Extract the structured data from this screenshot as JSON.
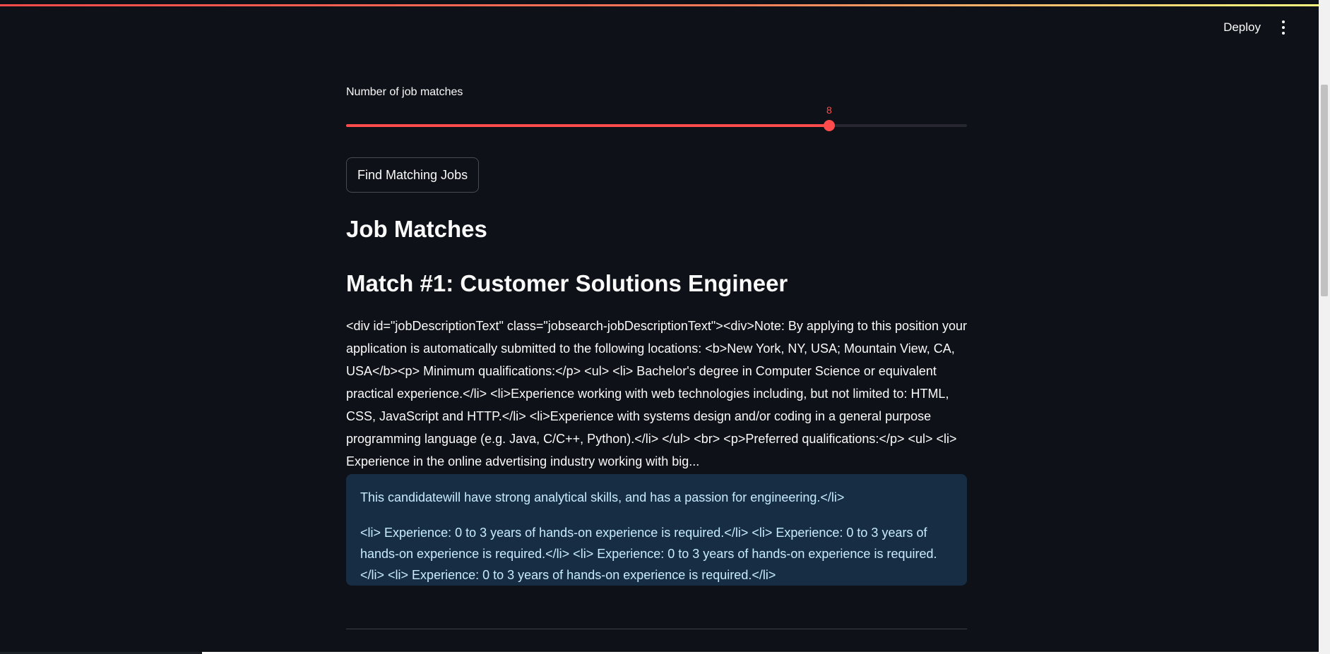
{
  "header": {
    "deploy_label": "Deploy",
    "menu_icon": "kebab-menu-icon"
  },
  "colors": {
    "background": "#0e1117",
    "accent": "#ff4b4b",
    "info_background": "#172d43",
    "info_text": "#c7ebff"
  },
  "slider": {
    "label": "Number of job matches",
    "value": 8,
    "fraction": 0.778
  },
  "actions": {
    "find_label": "Find Matching Jobs"
  },
  "results": {
    "heading": "Job Matches",
    "matches": [
      {
        "title": "Match #1: Customer Solutions Engineer",
        "description": "<div id=\"jobDescriptionText\" class=\"jobsearch-jobDescriptionText\"><div>Note: By applying to this position your application is automatically submitted to the following locations: <b>New York, NY, USA; Mountain View, CA, USA</b><p> Minimum qualifications:</p> <ul> <li> Bachelor's degree in Computer Science or equivalent practical experience.</li> <li>Experience working with web technologies including, but not limited to: HTML, CSS, JavaScript and HTTP.</li> <li>Experience with systems design and/or coding in a general purpose programming language (e.g. Java, C/C++, Python).</li> </ul> <br> <p>Preferred qualifications:</p> <ul> <li> Experience in the online advertising industry working with big...",
        "info_paragraphs": [
          "This candidatewill have strong analytical skills, and has a passion for engineering.</li>",
          "<li> Experience: 0 to 3 years of hands-on experience is required.</li> <li> Experience: 0 to 3 years of hands-on experience is required.</li> <li> Experience: 0 to 3 years of hands-on experience is required.</li> <li> Experience: 0 to 3 years of hands-on experience is required.</li>"
        ]
      }
    ]
  }
}
